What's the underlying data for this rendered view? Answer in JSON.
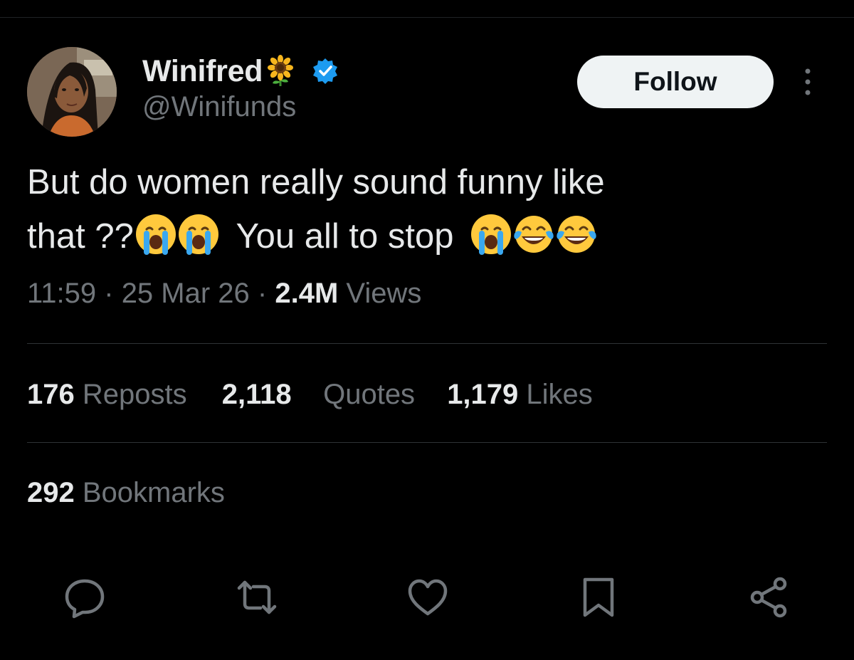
{
  "author": {
    "display_name": "Winifred",
    "name_emoji": "sunflower-emoji",
    "verified_icon": "verified-badge-icon",
    "handle": "@Winifunds",
    "avatar": "profile-photo"
  },
  "header": {
    "follow_label": "Follow",
    "more_icon": "more-vertical-icon"
  },
  "tweet": {
    "line1": "But do women really sound funny like",
    "line2_part1": "that ??",
    "line2_part2": "You all to stop",
    "emojis": [
      "loudly-crying-face",
      "loudly-crying-face",
      "loudly-crying-face",
      "face-with-tears-of-joy",
      "face-with-tears-of-joy"
    ]
  },
  "meta": {
    "time": "11:59",
    "separator": " · ",
    "date": "25 Mar 26",
    "views_count": "2.4M",
    "views_label": "Views"
  },
  "stats": {
    "reposts_count": "176",
    "reposts_label": "Reposts",
    "quotes_count": "2,118",
    "quotes_label": "Quotes",
    "likes_count": "1,179",
    "likes_label": "Likes",
    "bookmarks_count": "292",
    "bookmarks_label": "Bookmarks"
  },
  "actions": [
    "reply-icon",
    "repost-icon",
    "like-icon",
    "bookmark-icon",
    "share-icon"
  ],
  "colors": {
    "background": "#000000",
    "text_primary": "#e7e9ea",
    "text_secondary": "#71767b",
    "divider": "#2f3336",
    "verified_blue": "#1d9bf0",
    "follow_bg": "#eff3f4"
  }
}
